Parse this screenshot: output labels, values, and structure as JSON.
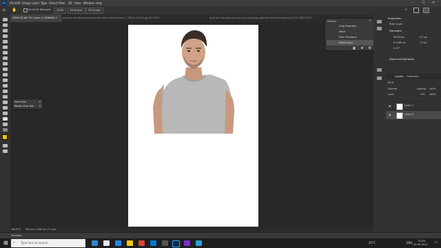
{
  "app": {
    "logo": "Ps"
  },
  "menu": [
    "File",
    "Edit",
    "Image",
    "Layer",
    "Type",
    "Select",
    "Filter",
    "3D",
    "View",
    "Window",
    "Help"
  ],
  "window_controls": [
    "–",
    "☐",
    "✕"
  ],
  "options_bar": {
    "scroll_all_label": "Scroll All Windows",
    "zoom_value": "100%",
    "fit_screen_label": "Fit Screen",
    "fill_screen_label": "Fill Screen"
  },
  "tabs": [
    "DEMO @ 66.7% (Layer 0, RGB/8#) *",
    "portrait-handsome-young-man-with-crossed-arms_176420-15549.jpg @ 100%",
    "portrait-charming-young-man-standing-against-white-background_23-2148215401"
  ],
  "tool_popup": {
    "items": [
      "Hand Tool",
      "Rotate View Tool"
    ],
    "shortcuts": [
      "H",
      "R"
    ]
  },
  "history_panel": {
    "title": "History",
    "items": [
      "Crop Selection",
      "Move",
      "Free Transform",
      "Make Layer"
    ]
  },
  "properties_panel": {
    "title": "Properties",
    "subtitle": "Pixel Layer",
    "transform_label": "Transform",
    "w": "W 850 px",
    "h": "H 1280 px",
    "x": "X 0 px",
    "y": "Y 0 px",
    "angle": "0.00°",
    "align_label": "Align and Distribute"
  },
  "layers_panel": {
    "tabs": [
      "Layers",
      "Channels"
    ],
    "kind_label": "Kind",
    "blend_mode": "Normal",
    "opacity_label": "Opacity:",
    "opacity_value": "100%",
    "lock_label": "Lock:",
    "fill_label": "Fill:",
    "fill_value": "100%",
    "layers": [
      "Layer 1",
      "Layer 0"
    ]
  },
  "status": {
    "zoom": "66.67%",
    "doc_size": "850 px x 1280 px (72 ppi)"
  },
  "timeline_label": "Timeline",
  "taskbar": {
    "search_placeholder": "Type here to search",
    "weather": "25°C",
    "lang": "ENG",
    "time": "12:54",
    "date": "20-06-2021"
  },
  "colors": {
    "accent": "#31a8ff",
    "panel": "#323232",
    "bg": "#282828"
  }
}
